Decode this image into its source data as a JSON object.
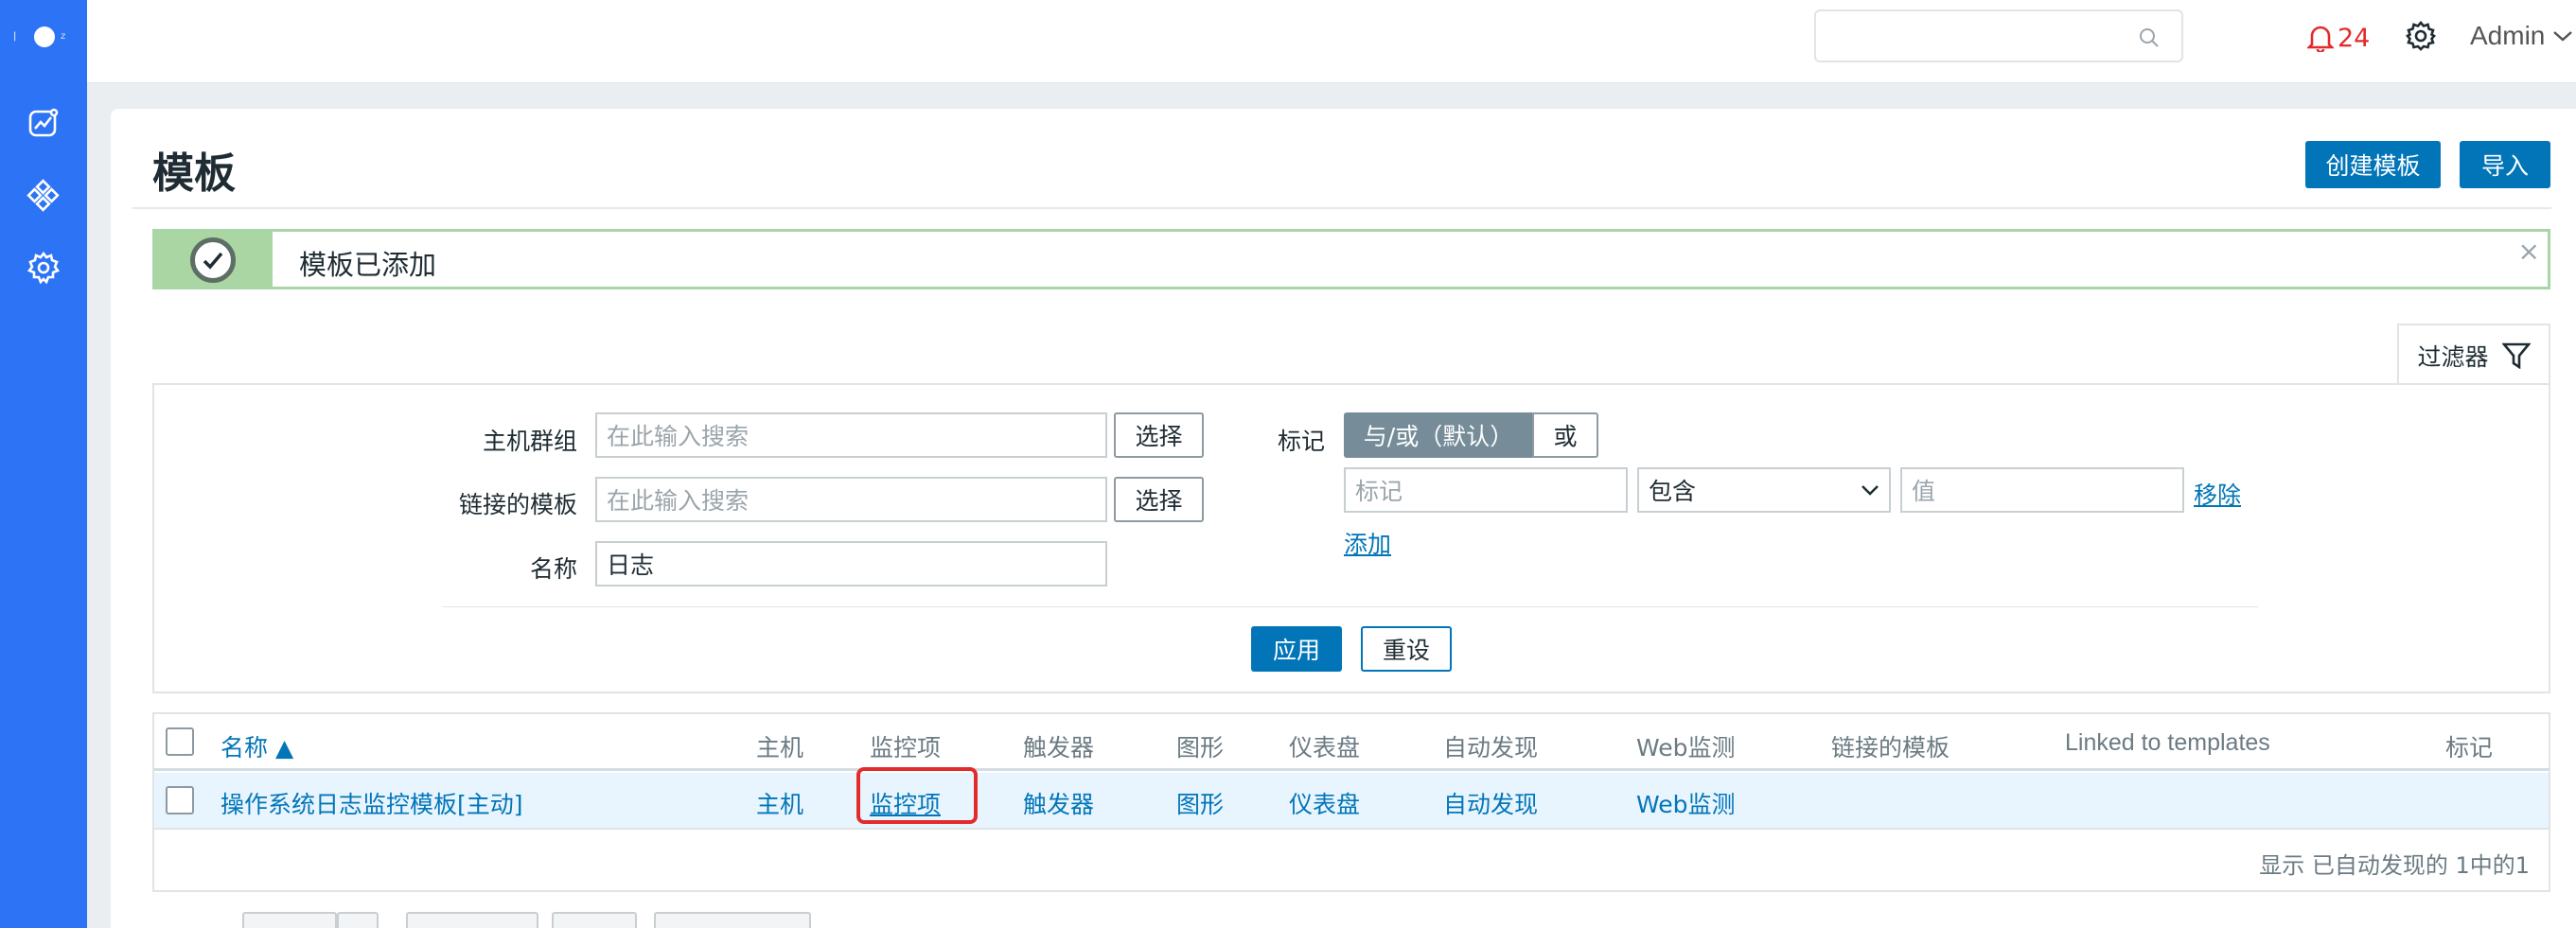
{
  "sidebar": {
    "logo_left": "|",
    "logo_right": "z",
    "items": [
      {
        "icon": "monitoring-icon"
      },
      {
        "icon": "services-icon"
      },
      {
        "icon": "settings-icon"
      }
    ],
    "accent": "#2d73f5"
  },
  "topbar": {
    "search_value": "",
    "notification_count": "24",
    "user": "Admin"
  },
  "page": {
    "title": "模板",
    "create_button": "创建模板",
    "import_button": "导入"
  },
  "message": {
    "text": "模板已添加",
    "close": "×"
  },
  "filter": {
    "tab_label": "过滤器",
    "host_group_label": "主机群组",
    "host_group_placeholder": "在此输入搜索",
    "linked_templates_label": "链接的模板",
    "linked_templates_placeholder": "在此输入搜索",
    "name_label": "名称",
    "name_value": "日志",
    "select_button": "选择",
    "tags_label": "标记",
    "tag_mode_and_or": "与/或（默认）",
    "tag_mode_or": "或",
    "tag_placeholder": "标记",
    "tag_operator": "包含",
    "tag_value_placeholder": "值",
    "remove_link": "移除",
    "add_link": "添加",
    "apply_button": "应用",
    "reset_button": "重设"
  },
  "table": {
    "columns": [
      "名称 ▲",
      "主机",
      "监控项",
      "触发器",
      "图形",
      "仪表盘",
      "自动发现",
      "Web监测",
      "链接的模板",
      "Linked to templates",
      "标记"
    ],
    "rows": [
      {
        "name": "操作系统日志监控模板[主动]",
        "hosts": "主机",
        "items": "监控项",
        "triggers": "触发器",
        "graphs": "图形",
        "dashboards": "仪表盘",
        "discovery": "自动发现",
        "web": "Web监测"
      }
    ],
    "footer": "显示 已自动发现的 1中的1"
  }
}
